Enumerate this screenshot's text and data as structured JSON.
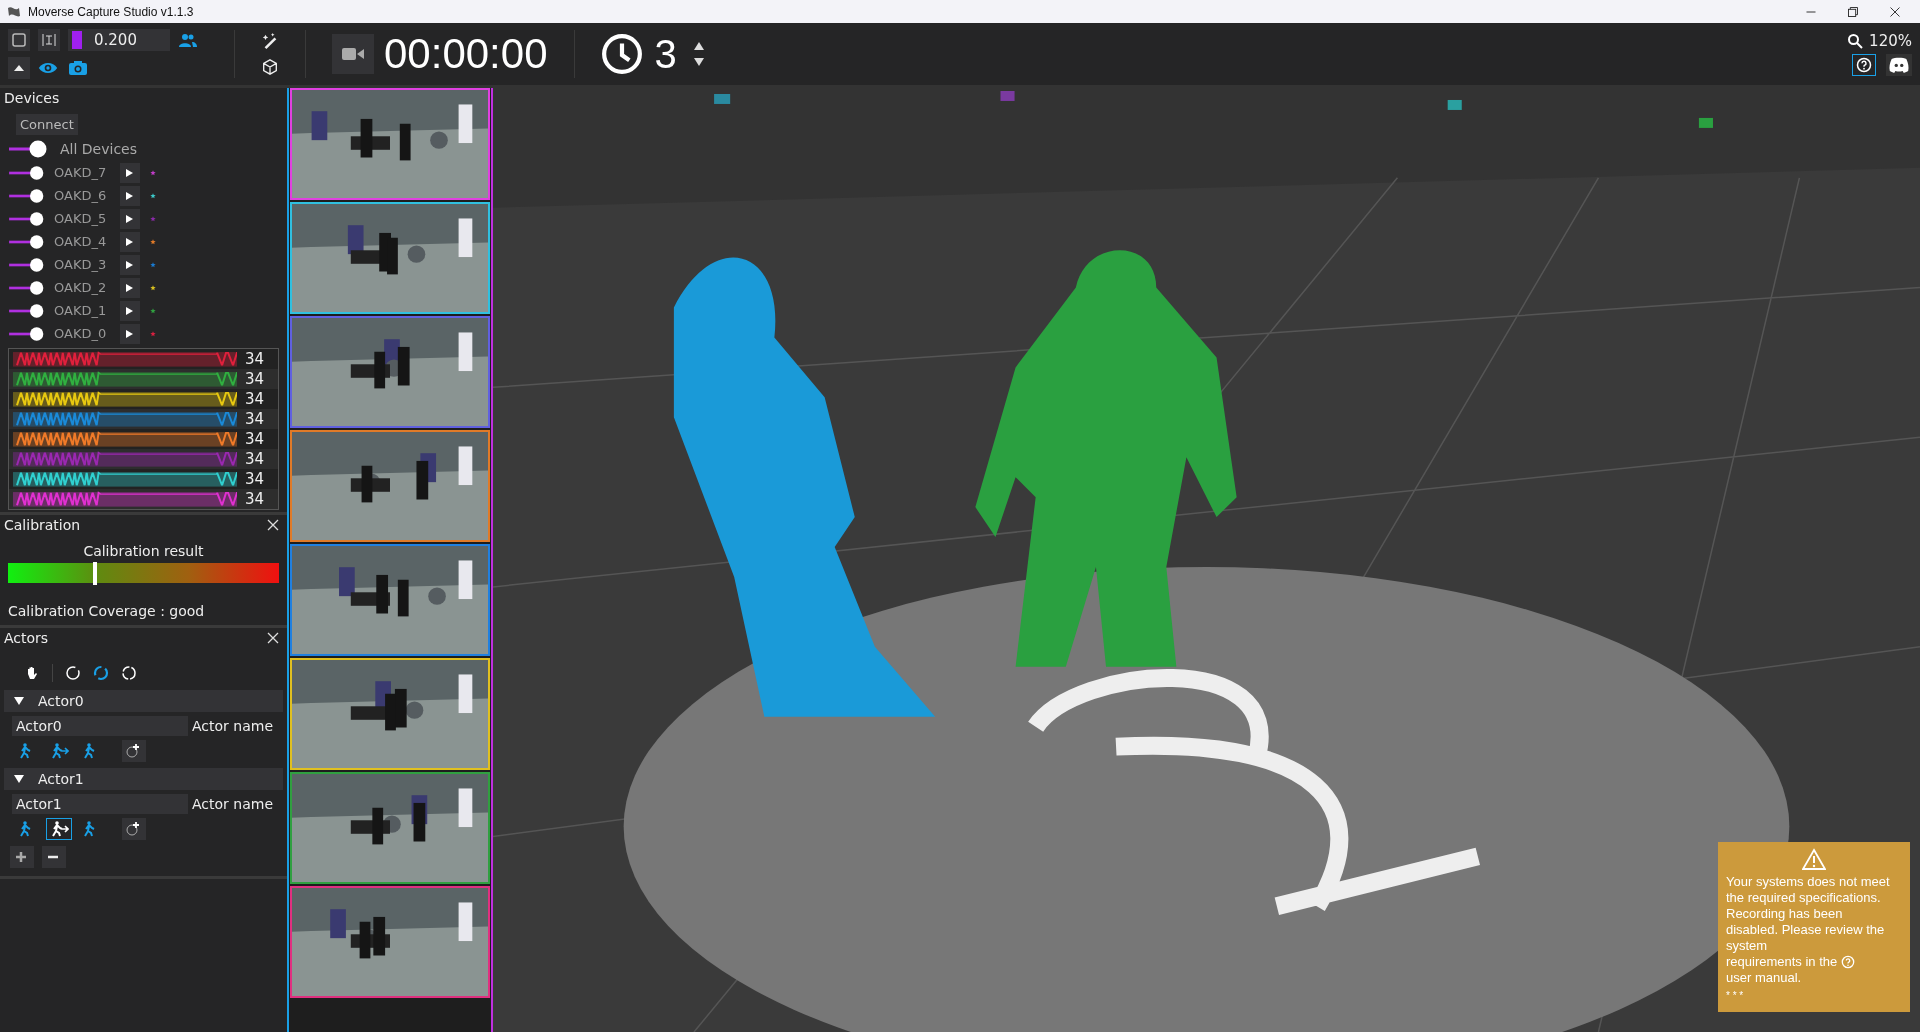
{
  "window": {
    "title": "Moverse Capture Studio v1.1.3"
  },
  "toolbar": {
    "threshold": "0.200",
    "timer": "00:00:00",
    "countdown": "3",
    "zoom": "120%"
  },
  "devices": {
    "title": "Devices",
    "connect": "Connect",
    "all_label": "All Devices",
    "all_on": true,
    "items": [
      {
        "name": "OAKD_7",
        "on": true,
        "color": "#c03cc8"
      },
      {
        "name": "OAKD_6",
        "on": true,
        "color": "#3cc8c8"
      },
      {
        "name": "OAKD_5",
        "on": true,
        "color": "#8a2aa8"
      },
      {
        "name": "OAKD_4",
        "on": true,
        "color": "#e07a28"
      },
      {
        "name": "OAKD_3",
        "on": true,
        "color": "#1a7ad0"
      },
      {
        "name": "OAKD_2",
        "on": true,
        "color": "#d8c020"
      },
      {
        "name": "OAKD_1",
        "on": true,
        "color": "#30a040"
      },
      {
        "name": "OAKD_0",
        "on": true,
        "color": "#d82040"
      }
    ],
    "streams": [
      {
        "color": "#e0203c",
        "reading": "34"
      },
      {
        "color": "#30b040",
        "reading": "34"
      },
      {
        "color": "#e8c810",
        "reading": "34"
      },
      {
        "color": "#1a8ad8",
        "reading": "34"
      },
      {
        "color": "#f07a28",
        "reading": "34"
      },
      {
        "color": "#9a28b0",
        "reading": "34"
      },
      {
        "color": "#30d0d0",
        "reading": "34"
      },
      {
        "color": "#e030d0",
        "reading": "34"
      }
    ]
  },
  "calibration": {
    "title": "Calibration",
    "result_label": "Calibration result",
    "level": 0.32,
    "coverage": "Calibration Coverage : good"
  },
  "actors": {
    "title": "Actors",
    "items": [
      {
        "header": "Actor0",
        "expanded": true,
        "name": "Actor0",
        "name_label": "Actor name",
        "modes": [
          {
            "selected": false
          },
          {
            "selected": false
          },
          {
            "selected": false
          }
        ]
      },
      {
        "header": "Actor1",
        "expanded": true,
        "name": "Actor1",
        "name_label": "Actor name",
        "modes": [
          {
            "selected": false
          },
          {
            "selected": true
          },
          {
            "selected": false
          }
        ]
      }
    ]
  },
  "cameras": [
    {
      "color": "#e040e0"
    },
    {
      "color": "#30c0e0"
    },
    {
      "color": "#6060e0"
    },
    {
      "color": "#e07a28"
    },
    {
      "color": "#2080e0"
    },
    {
      "color": "#e0c020"
    },
    {
      "color": "#30a040"
    },
    {
      "color": "#e03080"
    }
  ],
  "warning": {
    "text": "Your systems does not meet the required specifications. Recording has been disabled. Please review the system",
    "text_mid": "requirements in the",
    "text_end": "user manual.",
    "stars": "* * *"
  }
}
